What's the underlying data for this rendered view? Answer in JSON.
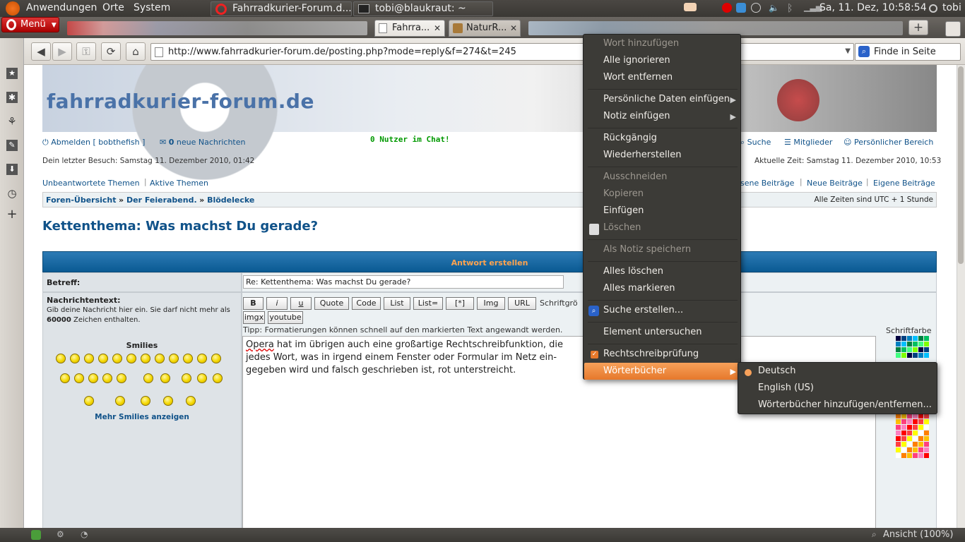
{
  "panel": {
    "apps": "Anwendungen",
    "places": "Orte",
    "system": "System",
    "task1": "Fahrradkurier-Forum.d...",
    "task2": "tobi@blaukraut: ~",
    "clock": "Sa, 11. Dez, 10:58:54",
    "user": "tobi"
  },
  "opera": {
    "menu": "Menü",
    "tabs": [
      "Fahrra...",
      "NaturR..."
    ],
    "add_tab": "+",
    "url": "http://www.fahrradkurier-forum.de/posting.php?mode=reply&f=274&t=245",
    "find_placeholder": "Finde in Seite",
    "zoom": "Ansicht (100%)"
  },
  "site": {
    "logo": "fahrradkurier-forum.de",
    "logout": "Abmelden [ bobthefish ]",
    "new_msgs_count": "0",
    "new_msgs": "neue Nachrichten",
    "chat": "0 Nutzer im Chat!",
    "search": "Suche",
    "members": "Mitglieder",
    "personal": "Persönlicher Bereich",
    "last_visit": "Dein letzter Besuch: Samstag 11. Dezember 2010, 01:42",
    "current_time": "Aktuelle Zeit: Samstag 11. Dezember 2010, 10:53",
    "unanswered": "Unbeantwortete Themen",
    "active": "Aktive Themen",
    "unread_part": "sene Beiträge",
    "new_posts": "Neue Beiträge",
    "own_posts": "Eigene Beiträge",
    "bread1": "Foren-Übersicht",
    "bread2": "Der Feierabend.",
    "bread3": "Blödelecke",
    "timezone": "Alle Zeiten sind UTC + 1 Stunde",
    "topic_title": "Kettenthema: Was machst Du gerade?",
    "form_title": "Antwort erstellen",
    "subject_label": "Betreff:",
    "subject_value": "Re: Kettenthema: Was machst Du gerade?",
    "msg_label": "Nachrichtentext:",
    "msg_hint1": "Gib deine Nachricht hier ein. Sie darf nicht mehr als",
    "msg_hint_num": "60000",
    "msg_hint2": "Zeichen enthalten.",
    "smilies": "Smilies",
    "more_smilies": "Mehr Smilies anzeigen",
    "bbcode": [
      "B",
      "i",
      "u",
      "Quote",
      "Code",
      "List",
      "List=",
      "[*]",
      "Img",
      "URL"
    ],
    "bbcode2": [
      "imgx",
      "youtube"
    ],
    "font_size": "Schriftgrö",
    "tip": "Tipp: Formatierungen können schnell auf den markierten Text angewandt werden.",
    "font_color": "Schriftfarbe",
    "text_line1_word": "Opera",
    "text_line1_rest": " hat im übrigen auch eine großartige Rechtschreibfunktion, die",
    "text_line2": "jedes Wort, was in irgend einem Fenster oder Formular im Netz ein-",
    "text_line3": "gegeben wird und falsch geschrieben ist, rot unterstreicht."
  },
  "context_menu": {
    "items": [
      "Wort hinzufügen",
      "Alle ignorieren",
      "Wort entfernen",
      "Persönliche Daten einfügen",
      "Notiz einfügen",
      "Rückgängig",
      "Wiederherstellen",
      "Ausschneiden",
      "Kopieren",
      "Einfügen",
      "Löschen",
      "Als Notiz speichern",
      "Alles löschen",
      "Alles markieren",
      "Suche erstellen...",
      "Element untersuchen",
      "Rechtschreibprüfung",
      "Wörterbücher"
    ],
    "submenu": [
      "Deutsch",
      "English (US)",
      "Wörterbücher hinzufügen/entfernen..."
    ]
  },
  "colors": {
    "accent": "#e6782b",
    "menu_bg": "#3c3b37",
    "link": "#105289",
    "chat_green": "#009900"
  }
}
